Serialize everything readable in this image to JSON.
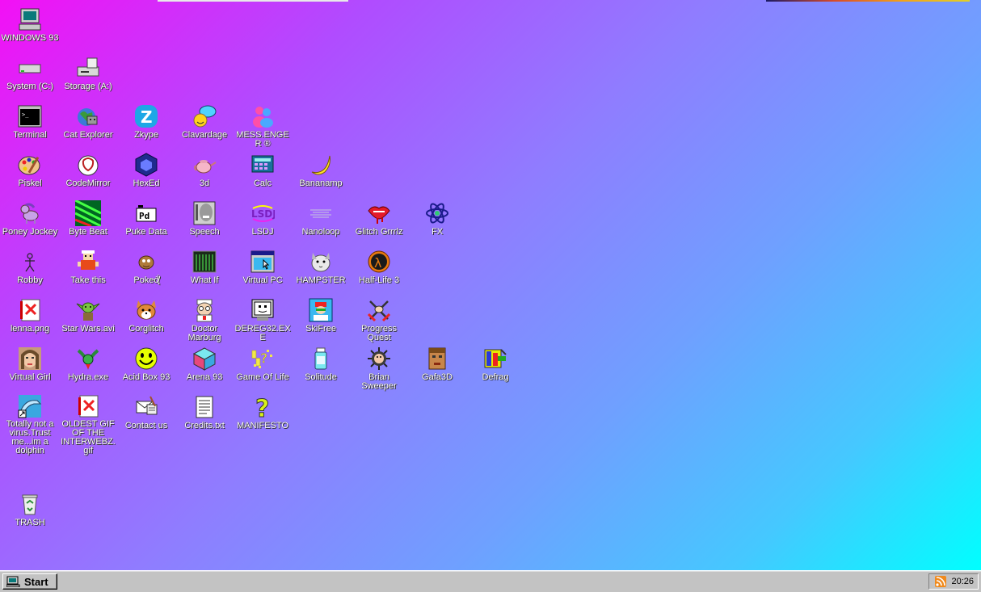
{
  "desktop": {
    "icons": [
      {
        "label": "WINDOWS 93",
        "icon": "computer-icon"
      },
      {
        "label": "System (C:)",
        "icon": "hard-drive-icon"
      },
      {
        "label": "Storage (A:)",
        "icon": "floppy-drive-icon"
      },
      {
        "label": "Terminal",
        "icon": "terminal-icon"
      },
      {
        "label": "Cat Explorer",
        "icon": "cat-explorer-icon"
      },
      {
        "label": "Zkype",
        "icon": "zkype-icon"
      },
      {
        "label": "Clavardage",
        "icon": "chat-bubble-icon"
      },
      {
        "label": "MESS.ENGER ®",
        "icon": "messenger-icon"
      },
      {
        "label": "Piskel",
        "icon": "paint-palette-icon"
      },
      {
        "label": "CodeMirror",
        "icon": "codemirror-icon"
      },
      {
        "label": "HexEd",
        "icon": "hex-cube-icon"
      },
      {
        "label": "3d",
        "icon": "teapot-icon"
      },
      {
        "label": "Calc",
        "icon": "calculator-icon"
      },
      {
        "label": "Bananamp",
        "icon": "banana-icon"
      },
      {
        "label": "Poney Jockey",
        "icon": "pony-icon"
      },
      {
        "label": "Byte Beat",
        "icon": "byte-beat-icon"
      },
      {
        "label": "Puke Data",
        "icon": "pd-icon"
      },
      {
        "label": "Speech",
        "icon": "speech-face-icon"
      },
      {
        "label": "LSDJ",
        "icon": "lsdj-icon"
      },
      {
        "label": "Nanoloop",
        "icon": "nanoloop-icon"
      },
      {
        "label": "Glitch Grrrlz",
        "icon": "lips-icon"
      },
      {
        "label": "FX",
        "icon": "atom-icon"
      },
      {
        "label": "Robby",
        "icon": "stick-figure-icon"
      },
      {
        "label": "Take this",
        "icon": "take-this-icon"
      },
      {
        "label": "Pokeḋ̸̨̛͔́",
        "icon": "poke-ball-icon"
      },
      {
        "label": "What If",
        "icon": "what-if-icon"
      },
      {
        "label": "Virtual PC",
        "icon": "virtual-pc-icon"
      },
      {
        "label": "HAMPSTER",
        "icon": "hamster-icon"
      },
      {
        "label": "Half-Life 3",
        "icon": "half-life-icon"
      },
      {
        "label": "lenna.png",
        "icon": "image-file-icon"
      },
      {
        "label": "Star Wars.avi",
        "icon": "yoda-icon"
      },
      {
        "label": "Corglitch",
        "icon": "corgi-icon"
      },
      {
        "label": "Doctor Marburg",
        "icon": "doctor-icon"
      },
      {
        "label": "DEREG32.EXE",
        "icon": "dereg-icon"
      },
      {
        "label": "SkiFree",
        "icon": "skifree-icon"
      },
      {
        "label": "Progress Quest",
        "icon": "crossed-swords-icon"
      },
      {
        "label": "Virtual Girl",
        "icon": "virtual-girl-icon"
      },
      {
        "label": "Hydra.exe",
        "icon": "hydra-icon"
      },
      {
        "label": "Acid Box 93",
        "icon": "smiley-icon"
      },
      {
        "label": "Arena 93",
        "icon": "cube-icon"
      },
      {
        "label": "Game Of Life",
        "icon": "game-of-life-icon"
      },
      {
        "label": "Solitude",
        "icon": "solitude-icon"
      },
      {
        "label": "Brian Sweeper",
        "icon": "mine-icon"
      },
      {
        "label": "Gafa3D",
        "icon": "doom-face-icon"
      },
      {
        "label": "Defrag",
        "icon": "defrag-icon"
      },
      {
        "label": "Totally not a virus.Trust me...im a dolphin",
        "icon": "dolphin-shortcut-icon"
      },
      {
        "label": "OLDEST GIF OF THE INTERWEBZ.gif",
        "icon": "gif-file-icon"
      },
      {
        "label": "Contact us",
        "icon": "contact-icon"
      },
      {
        "label": "Credits.txt",
        "icon": "text-file-icon"
      },
      {
        "label": "MANIFESTO",
        "icon": "question-mark-icon"
      },
      {
        "label": "TRASH",
        "icon": "recycle-bin-icon"
      }
    ]
  },
  "taskbar": {
    "start_label": "Start",
    "clock": "20:26",
    "tray_icon": "rss-icon"
  }
}
